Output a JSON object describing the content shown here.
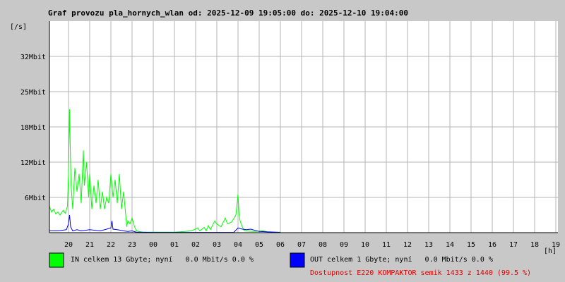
{
  "title": "Graf provozu pla_hornych_wlan od: 2025-12-09 19:05:00 do: 2025-12-10 19:04:00",
  "y_unit": "[/s]",
  "x_unit": "[h]",
  "legend": {
    "in_text": "IN celkem 13 Gbyte; nyní   0.0 Mbit/s 0.0 %",
    "out_text": "OUT celkem 1 Gbyte; nyní   0.0 Mbit/s 0.0 %",
    "in_color": "#00ff00",
    "out_color": "#0000ff"
  },
  "availability": "Dostupnost E220 KOMPAKTOR semik 1433 z 1440 (99.5 %)",
  "chart_data": {
    "type": "line",
    "title": "Graf provozu pla_hornych_wlan od: 2025-12-09 19:05:00 do: 2025-12-10 19:04:00",
    "xlabel": "[h]",
    "ylabel": "[/s]",
    "x_ticks": [
      "20",
      "21",
      "22",
      "23",
      "00",
      "01",
      "02",
      "03",
      "04",
      "05",
      "06",
      "07",
      "08",
      "09",
      "10",
      "11",
      "12",
      "13",
      "14",
      "15",
      "16",
      "17",
      "18",
      "19"
    ],
    "y_ticks": [
      "6Mbit",
      "12Mbit",
      "18Mbit",
      "25Mbit",
      "32Mbit"
    ],
    "y_tick_values": [
      6,
      12,
      18,
      24,
      30
    ],
    "ylim": [
      0,
      36
    ],
    "x_range_hours": [
      19.1,
      29.1
    ],
    "grid": true,
    "series": [
      {
        "name": "IN",
        "color": "#00ff00",
        "points": [
          [
            19.08,
            4.5
          ],
          [
            19.2,
            3.5
          ],
          [
            19.3,
            4
          ],
          [
            19.4,
            3.2
          ],
          [
            19.5,
            3.5
          ],
          [
            19.6,
            3
          ],
          [
            19.75,
            3.8
          ],
          [
            19.85,
            3.3
          ],
          [
            19.95,
            4.5
          ],
          [
            20.0,
            10
          ],
          [
            20.05,
            21
          ],
          [
            20.08,
            15
          ],
          [
            20.12,
            8
          ],
          [
            20.2,
            4
          ],
          [
            20.3,
            11
          ],
          [
            20.4,
            7
          ],
          [
            20.5,
            10
          ],
          [
            20.6,
            5
          ],
          [
            20.7,
            14
          ],
          [
            20.75,
            8
          ],
          [
            20.85,
            12
          ],
          [
            20.95,
            6
          ],
          [
            21.0,
            10
          ],
          [
            21.1,
            4
          ],
          [
            21.2,
            8
          ],
          [
            21.3,
            5
          ],
          [
            21.4,
            9
          ],
          [
            21.5,
            4
          ],
          [
            21.6,
            7
          ],
          [
            21.7,
            4
          ],
          [
            21.8,
            6
          ],
          [
            21.9,
            5
          ],
          [
            22.0,
            10
          ],
          [
            22.1,
            6
          ],
          [
            22.2,
            9
          ],
          [
            22.3,
            5
          ],
          [
            22.4,
            10
          ],
          [
            22.5,
            4
          ],
          [
            22.6,
            7
          ],
          [
            22.7,
            3
          ],
          [
            22.75,
            1
          ],
          [
            22.8,
            2
          ],
          [
            22.9,
            1.5
          ],
          [
            23.0,
            2.5
          ],
          [
            23.1,
            1.2
          ],
          [
            23.2,
            0.3
          ],
          [
            23.5,
            0.1
          ],
          [
            25.0,
            0.1
          ],
          [
            25.5,
            0.2
          ],
          [
            25.8,
            0.3
          ],
          [
            26.1,
            0.8
          ],
          [
            26.2,
            0.3
          ],
          [
            26.4,
            0.9
          ],
          [
            26.5,
            0.3
          ],
          [
            26.6,
            1.2
          ],
          [
            26.7,
            0.5
          ],
          [
            26.9,
            2
          ],
          [
            27.0,
            1.5
          ],
          [
            27.2,
            1
          ],
          [
            27.4,
            2.5
          ],
          [
            27.5,
            1.5
          ],
          [
            27.7,
            1.8
          ],
          [
            27.9,
            3
          ],
          [
            28.0,
            6.5
          ],
          [
            28.05,
            3
          ],
          [
            28.1,
            2
          ],
          [
            28.2,
            1
          ],
          [
            28.3,
            0.3
          ],
          [
            28.8,
            0.2
          ],
          [
            29.2,
            0.3
          ],
          [
            29.4,
            0.1
          ],
          [
            30.0,
            0.1
          ]
        ]
      },
      {
        "name": "OUT",
        "color": "#0000ff",
        "points": [
          [
            19.08,
            0.3
          ],
          [
            19.5,
            0.3
          ],
          [
            19.9,
            0.5
          ],
          [
            20.0,
            1.5
          ],
          [
            20.05,
            3
          ],
          [
            20.1,
            1
          ],
          [
            20.2,
            0.3
          ],
          [
            20.4,
            0.5
          ],
          [
            20.6,
            0.3
          ],
          [
            21.0,
            0.5
          ],
          [
            21.5,
            0.3
          ],
          [
            22.0,
            0.8
          ],
          [
            22.05,
            2
          ],
          [
            22.1,
            0.6
          ],
          [
            22.3,
            0.5
          ],
          [
            22.6,
            0.3
          ],
          [
            22.8,
            0.2
          ],
          [
            23.0,
            0.3
          ],
          [
            23.2,
            0.1
          ],
          [
            24.0,
            0.05
          ],
          [
            27.8,
            0.05
          ],
          [
            28.0,
            0.8
          ],
          [
            28.2,
            0.6
          ],
          [
            28.4,
            0.5
          ],
          [
            28.6,
            0.6
          ],
          [
            28.8,
            0.4
          ],
          [
            29.0,
            0.2
          ],
          [
            30.0,
            0.05
          ]
        ]
      }
    ]
  }
}
